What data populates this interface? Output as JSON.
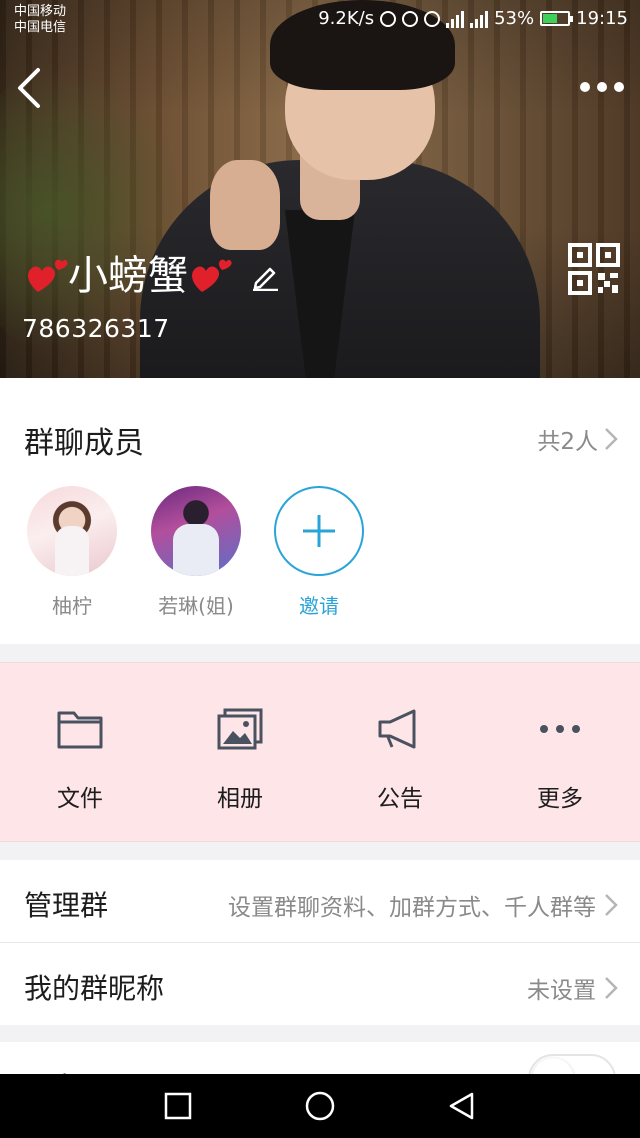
{
  "status_bar": {
    "carrier_1": "中国移动",
    "carrier_2": "中国电信",
    "net_speed": "9.2K/s",
    "battery_percent": "53%",
    "battery_level": 0.53,
    "time": "19:15",
    "colors": {
      "battery_fill": "#3fd05a"
    }
  },
  "header": {
    "back_icon": "chevron-left-icon",
    "more_icon": "more-dots-icon",
    "group_name": "小螃蟹",
    "name_decoration_icon": "red-hearts-icon",
    "edit_icon": "pencil-icon",
    "group_id": "786326317",
    "qr_icon": "qr-code-icon"
  },
  "members": {
    "title": "群聊成员",
    "count_label": "共2人",
    "list": [
      {
        "name": "柚柠"
      },
      {
        "name": "若琳(姐)"
      }
    ],
    "invite_label": "邀请",
    "colors": {
      "invite": "#2aa4d8"
    }
  },
  "functions": {
    "background": "#fde5e8",
    "items": [
      {
        "label": "文件",
        "icon": "folder-icon"
      },
      {
        "label": "相册",
        "icon": "photo-album-icon"
      },
      {
        "label": "公告",
        "icon": "megaphone-icon"
      },
      {
        "label": "更多",
        "icon": "more-dots-icon"
      }
    ]
  },
  "settings": {
    "manage_group": {
      "label": "管理群",
      "value": "设置群聊资料、加群方式、千人群等"
    },
    "my_nickname": {
      "label": "我的群昵称",
      "value": "未设置"
    },
    "pin_chat": {
      "label": "设为置顶",
      "enabled": false
    }
  },
  "navbar": {
    "buttons": [
      "recent-apps-icon",
      "home-icon",
      "back-triangle-icon"
    ]
  }
}
